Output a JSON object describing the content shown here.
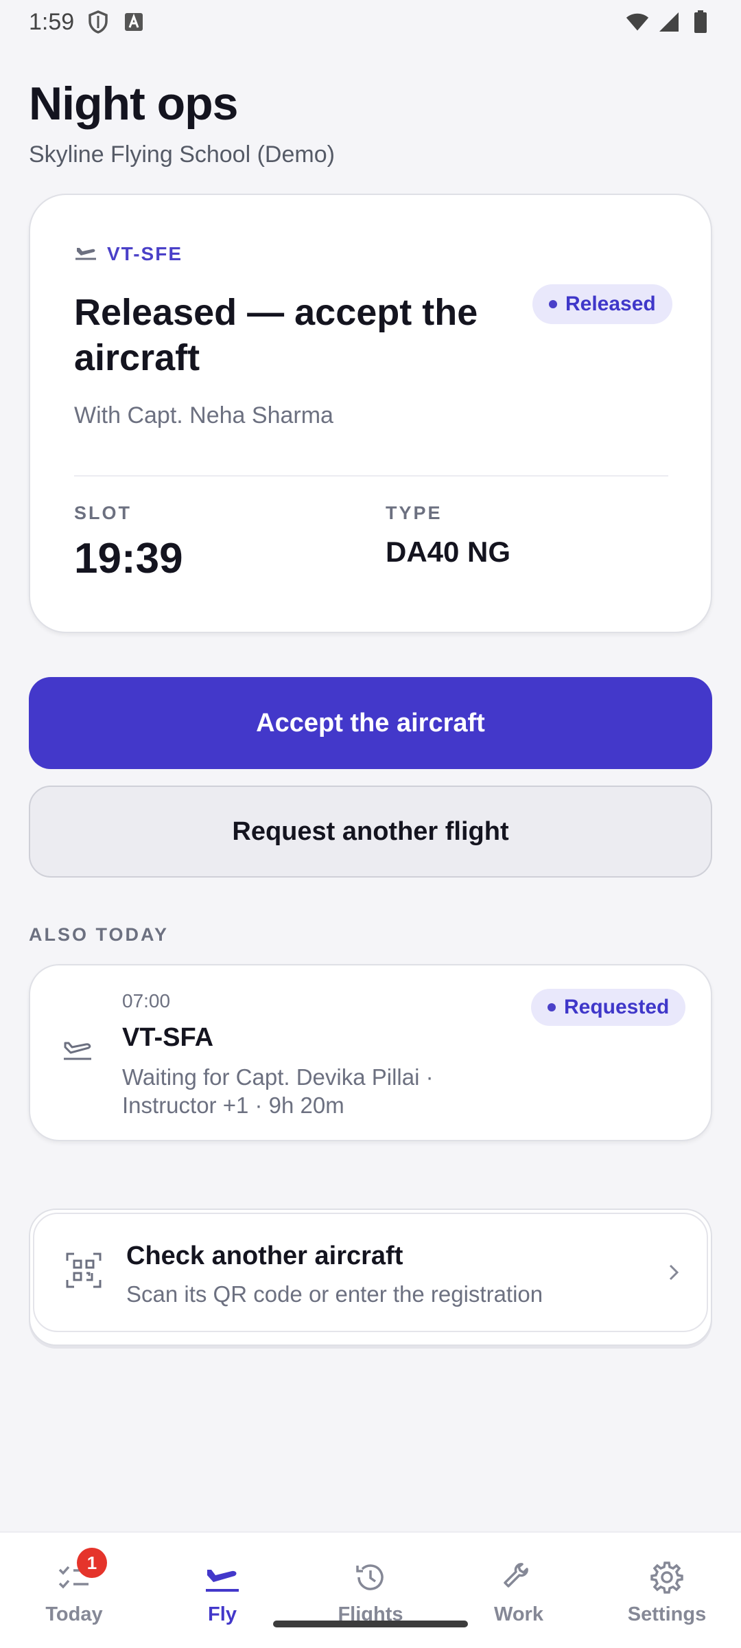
{
  "status_bar": {
    "time": "1:59",
    "icons": [
      "shield-icon",
      "a-icon",
      "wifi-icon",
      "signal-icon",
      "battery-icon"
    ]
  },
  "header": {
    "title": "Night ops",
    "subtitle": "Skyline Flying School (Demo)"
  },
  "current_flight": {
    "registration": "VT-SFE",
    "heading": "Released — accept the aircraft",
    "status": "Released",
    "with": "With Capt. Neha Sharma",
    "slot_label": "SLOT",
    "slot_value": "19:39",
    "type_label": "TYPE",
    "type_value": "DA40 NG"
  },
  "actions": {
    "accept": "Accept the aircraft",
    "request": "Request another flight"
  },
  "also_today": {
    "label": "ALSO TODAY",
    "flights": [
      {
        "time": "07:00",
        "registration": "VT-SFA",
        "status": "Requested",
        "detail": "Waiting for Capt. Devika Pillai · Instructor +1 · 9h 20m"
      }
    ]
  },
  "check_aircraft": {
    "title": "Check another aircraft",
    "subtitle": "Scan its QR code or enter the registration"
  },
  "nav": {
    "items": [
      {
        "label": "Today",
        "icon": "checklist-icon",
        "badge": "1"
      },
      {
        "label": "Fly",
        "icon": "takeoff-icon",
        "active": true
      },
      {
        "label": "Flights",
        "icon": "history-icon"
      },
      {
        "label": "Work",
        "icon": "wrench-icon"
      },
      {
        "label": "Settings",
        "icon": "gear-icon"
      }
    ]
  },
  "colors": {
    "accent": "#4338ca",
    "pill_bg": "#e9e8fb",
    "badge": "#e5342b",
    "background": "#f5f5f8"
  }
}
